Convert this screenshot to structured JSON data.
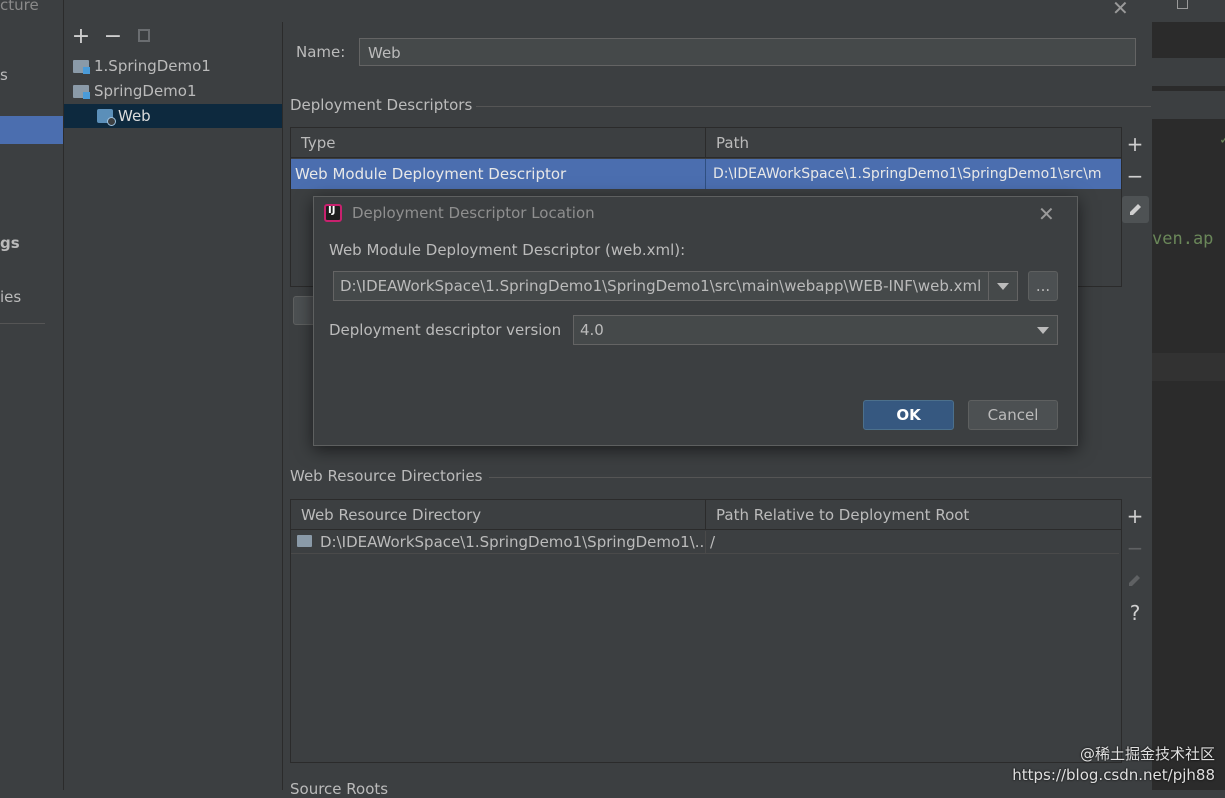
{
  "window": {
    "title_fragment": "cture"
  },
  "left_sidebar": {
    "fragments": [
      "s",
      "gs",
      "ies"
    ]
  },
  "tree": {
    "toolbar": {
      "add": "+",
      "remove": "−"
    },
    "items": [
      {
        "label": "1.SpringDemo1",
        "icon": "module-folder-icon"
      },
      {
        "label": "SpringDemo1",
        "icon": "module-folder-icon"
      },
      {
        "label": "Web",
        "icon": "web-facet-icon"
      }
    ]
  },
  "form": {
    "name_label": "Name:",
    "name_value": "Web",
    "deployment_section": "Deployment Descriptors",
    "dd_table": {
      "headers": [
        "Type",
        "Path"
      ],
      "rows": [
        {
          "type": "Web Module Deployment Descriptor",
          "path": "D:\\IDEAWorkSpace\\1.SpringDemo1\\SpringDemo1\\src\\m"
        }
      ]
    },
    "side_buttons": [
      "+",
      "−"
    ],
    "web_resource_section": "Web Resource Directories",
    "wr_table": {
      "headers": [
        "Web Resource Directory",
        "Path Relative to Deployment Root"
      ],
      "rows": [
        {
          "directory": "D:\\IDEAWorkSpace\\1.SpringDemo1\\SpringDemo1\\...",
          "relative": "/"
        }
      ]
    },
    "wr_side_buttons": [
      "+",
      "−",
      "?"
    ],
    "source_roots_fragment": "Source Roots"
  },
  "dialog": {
    "title": "Deployment Descriptor Location",
    "descriptor_label": "Web Module Deployment Descriptor (web.xml):",
    "descriptor_path": "D:\\IDEAWorkSpace\\1.SpringDemo1\\SpringDemo1\\src\\main\\webapp\\WEB-INF\\web.xml",
    "browse_label": "...",
    "version_label": "Deployment descriptor version",
    "version_value": "4.0",
    "ok_label": "OK",
    "cancel_label": "Cancel"
  },
  "editor_strip": {
    "code_fragment": "ven.ap"
  },
  "watermark": {
    "line1": "@稀土掘金技术社区",
    "line2": "https://blog.csdn.net/pjh88"
  },
  "colors": {
    "accent": "#4b6eaf",
    "selection_dark": "#0d293e",
    "ok_button": "#365880",
    "background": "#3c3f41"
  }
}
